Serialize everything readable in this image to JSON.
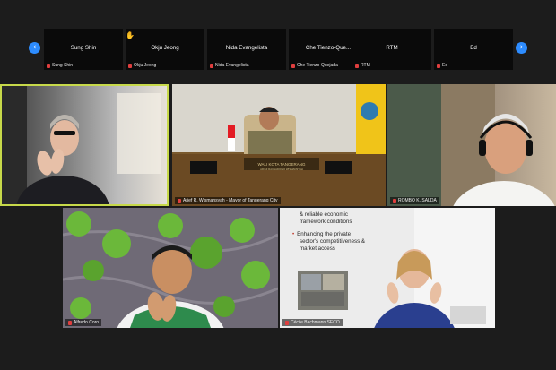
{
  "strip": {
    "thumbnails": [
      {
        "name": "Sung Shin",
        "label": "Sung Shin"
      },
      {
        "name": "Okju Jeong",
        "label": "Okju Jeong"
      },
      {
        "name": "Nida Evangelista",
        "label": "Nida Evangelista"
      },
      {
        "name": "Che  Tienzo-Que...",
        "label": "Che Tienzo-Quejada"
      },
      {
        "name": "RTM",
        "label": "RTM"
      },
      {
        "name": "Ed",
        "label": "Ed"
      }
    ],
    "prev_icon": "‹",
    "next_icon": "›",
    "wave_icon": "✋"
  },
  "tiles": {
    "t2": {
      "label": "Arief R. Wismansyah - Mayor of Tangerang City",
      "banner": "WALI KOTA TANGERANG",
      "banner_sub": "ARIEF RACHADIONO WISMANSYAH"
    },
    "t3": {
      "label": "ROMBO K. SALDA"
    },
    "t4": {
      "label": "Alfredo Coro"
    },
    "t5": {
      "label": "Cécile Bachmann SECO",
      "slide_line1": "& reliable economic",
      "slide_line2": "framework conditions",
      "slide_bullet2_line1": "Enhancing the private",
      "slide_bullet2_line2": "sector's competitiveness &",
      "slide_bullet2_line3": "market access"
    }
  },
  "colors": {
    "accent": "#2d8cff",
    "active_speaker": "#c7d94a",
    "mic_off": "#e03e3e"
  }
}
